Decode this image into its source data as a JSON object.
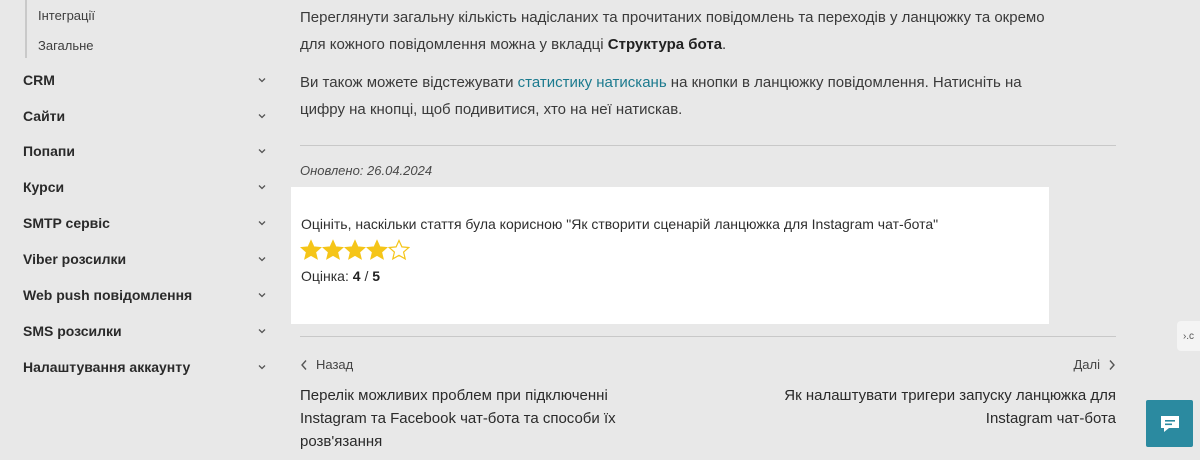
{
  "sidebar": {
    "sub_items": [
      "Інтеграції",
      "Загальне"
    ],
    "items": [
      {
        "label": "CRM"
      },
      {
        "label": "Сайти"
      },
      {
        "label": "Попапи"
      },
      {
        "label": "Курси"
      },
      {
        "label": "SMTP сервіс"
      },
      {
        "label": "Viber розсилки"
      },
      {
        "label": "Web push повідомлення"
      },
      {
        "label": "SMS розсилки"
      },
      {
        "label": "Налаштування аккаунту"
      }
    ]
  },
  "content": {
    "para1_line1": "Переглянути загальну кількість надісланих та прочитаних повідомлень та переходів у ланцюжку та окремо",
    "para1_line2_prefix": "для кожного повідомлення можна у вкладці ",
    "para1_line2_bold": "Структура бота",
    "para1_line2_suffix": ".",
    "para2_prefix": "Ви також можете відстежувати ",
    "para2_link": "статистику натискань",
    "para2_line1_suffix": " на кнопки в ланцюжку повідомлення. Натисніть на",
    "para2_line2": "цифру на кнопці, щоб подивитися, хто на неї натискав.",
    "updated": "Оновлено: 26.04.2024"
  },
  "rating": {
    "question": "Оцініть, наскільки стаття була корисною \"Як створити сценарій ланцюжка для Instagram чат-бота\"",
    "value": 4,
    "max": 5,
    "score_label": "Оцінка:",
    "score_value": "4",
    "score_sep": "/",
    "score_max": "5",
    "star_color": "#f5c518"
  },
  "pagination": {
    "prev_label": "Назад",
    "next_label": "Далі",
    "prev_title_lines": [
      "Перелік можливих проблем при підключенні",
      "Instagram та Facebook чат-бота та способи їх",
      "розв'язання"
    ],
    "next_title_lines": [
      "Як налаштувати тригери запуску ланцюжка для",
      "Instagram чат-бота"
    ]
  },
  "widgets": {
    "edge_tab_label": "›.c",
    "chat_icon": "chat-bubble-icon",
    "accent_color": "#2b8aa0"
  }
}
